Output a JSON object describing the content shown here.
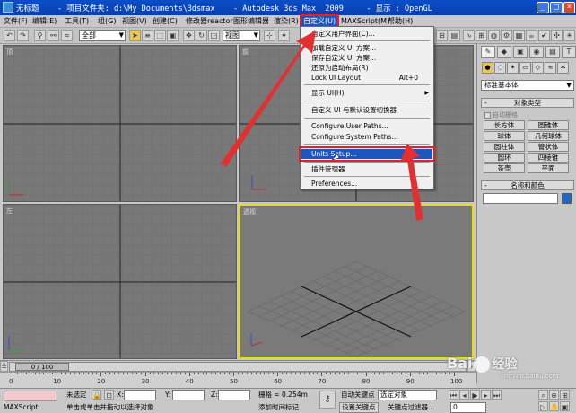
{
  "titlebar": {
    "title": "无标题    - 项目文件夹: d:\\My Documents\\3dsmax    - Autodesk 3ds Max  2009     - 显示 : OpenGL",
    "min": "_",
    "max": "□",
    "close": "×"
  },
  "menubar": {
    "items": [
      "文件(F)",
      "编辑(E)",
      "工具(T)",
      "组(G)",
      "视图(V)",
      "创建(C)",
      "修改器",
      "reactor",
      "动画",
      "图形编辑器",
      "渲染(R)",
      "自定义(U)",
      "MAXScript(M)",
      "帮助(H)"
    ]
  },
  "toolbar": {
    "selection_filter": "全部",
    "ref_coord": "视图",
    "named_sets": ""
  },
  "viewports": {
    "top": "顶",
    "front": "前",
    "left": "左",
    "perspective": "透视"
  },
  "dropdown": {
    "items": [
      {
        "label": "自定义用户界面(C)...",
        "shortcut": "",
        "sub": false
      },
      {
        "label": "加载自定义 UI 方案...",
        "shortcut": "",
        "sub": false
      },
      {
        "label": "保存自定义 UI 方案...",
        "shortcut": "",
        "sub": false
      },
      {
        "label": "还原为启动布局(R)",
        "shortcut": "",
        "sub": false
      },
      {
        "label": "Lock UI Layout",
        "shortcut": "Alt+0",
        "sub": false
      },
      {
        "label": "显示 UI(H)",
        "shortcut": "",
        "sub": true
      },
      {
        "label": "自定义 UI 与默认设置切换器",
        "shortcut": "",
        "sub": false
      },
      {
        "label": "Configure User Paths...",
        "shortcut": "",
        "sub": false
      },
      {
        "label": "Configure System Paths...",
        "shortcut": "",
        "sub": false
      },
      {
        "label": "Units Setup...",
        "shortcut": "",
        "sub": false
      },
      {
        "label": "插件管理器",
        "shortcut": "",
        "sub": false
      },
      {
        "label": "Preferences...",
        "shortcut": "",
        "sub": false
      }
    ]
  },
  "command_panel": {
    "tabs": [
      "✎",
      "◆",
      "▣",
      "◉",
      "▤",
      "T"
    ],
    "category": "标准基本体",
    "object_type_title": "对象类型",
    "auto_grid": "自动栅格",
    "objects": [
      "长方体",
      "圆锥体",
      "球体",
      "几何球体",
      "圆柱体",
      "管状体",
      "圆环",
      "四棱锥",
      "茶壶",
      "平面"
    ],
    "name_color_title": "名称和颜色",
    "color": "#2066c8"
  },
  "timebar": {
    "frame": "0 / 100",
    "ticks": [
      "0",
      "10",
      "20",
      "30",
      "40",
      "50",
      "60",
      "70",
      "80",
      "90",
      "100"
    ]
  },
  "statusbar": {
    "maxscript": "MAXScript.",
    "selection": "未选定",
    "prompt": "单击或单击并拖动以选择对象",
    "x_label": "X:",
    "y_label": "Y:",
    "z_label": "Z:",
    "grid": "栅格 = 0.254m",
    "add_time_tag": "添加时间标记",
    "auto_key": "自动关键点",
    "set_key": "设置关键点",
    "selected": "选定对象",
    "key_filters": "关键点过滤器...",
    "frame_value": "0"
  },
  "watermark": {
    "brand": "Bai",
    "brand2": "经验",
    "url": "jingyan.baidu.com"
  }
}
